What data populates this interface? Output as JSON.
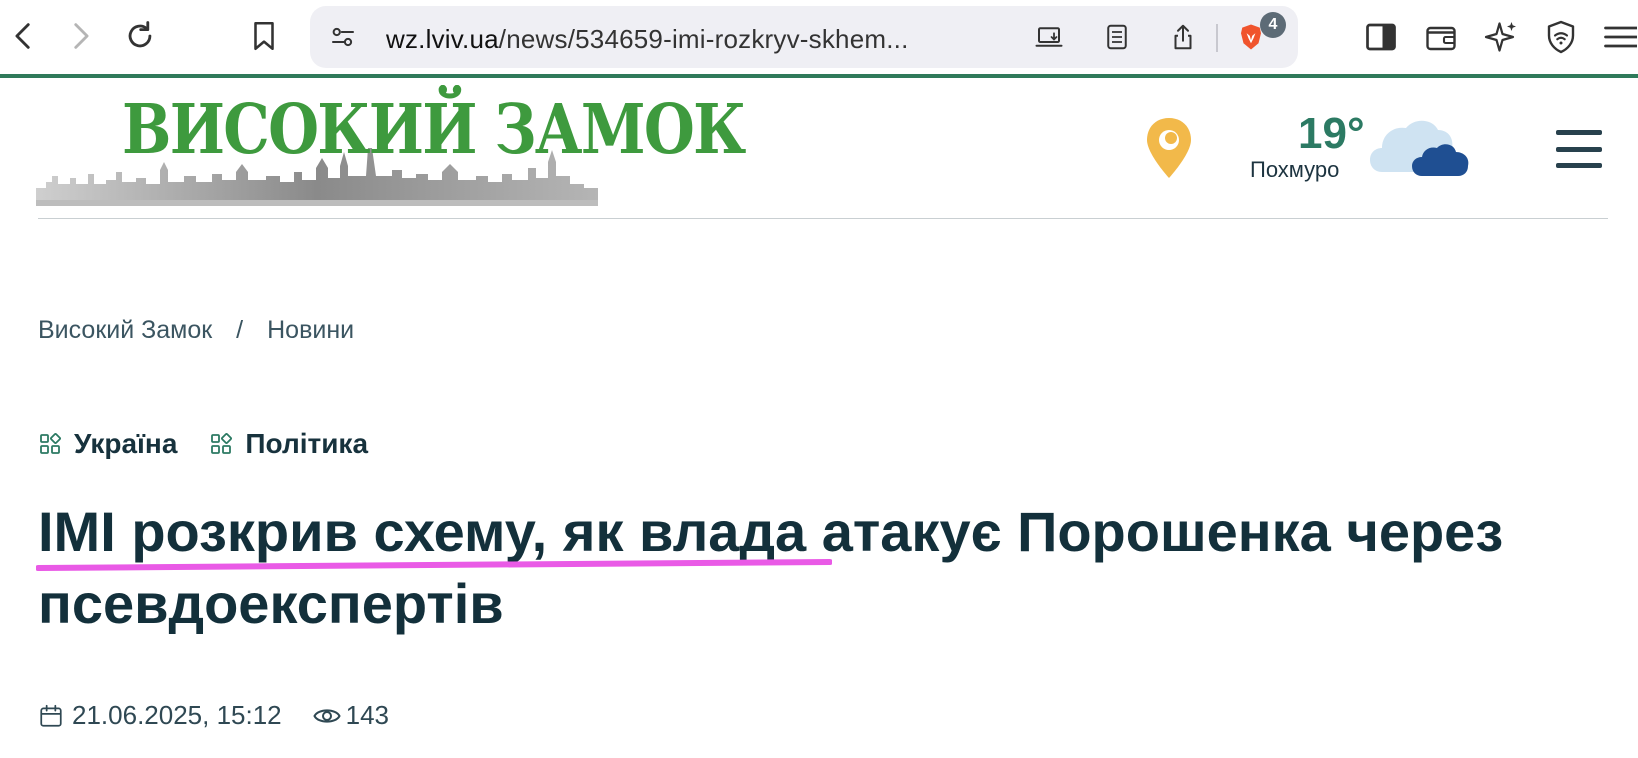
{
  "browser": {
    "url_domain": "wz.lviv.ua",
    "url_path": "/news/534659-imi-rozkryv-skhem...",
    "shields_count": "4"
  },
  "site": {
    "logo_text": "ВИСОКИЙ ЗАМОК",
    "weather": {
      "temperature": "19°",
      "condition": "Похмуро"
    }
  },
  "breadcrumb": {
    "home": "Високий Замок",
    "separator": "/",
    "section": "Новини"
  },
  "article": {
    "categories": [
      "Україна",
      "Політика"
    ],
    "title": "ІМІ розкрив схему, як влада атакує Порошенка через псевдоекспертів",
    "date": "21.06.2025, 15:12",
    "views": "143"
  },
  "colors": {
    "accent_green": "#3e9a3e",
    "toolbar_border": "#2f7a5a",
    "highlight": "#e95ae6",
    "pin": "#f2b94a"
  }
}
